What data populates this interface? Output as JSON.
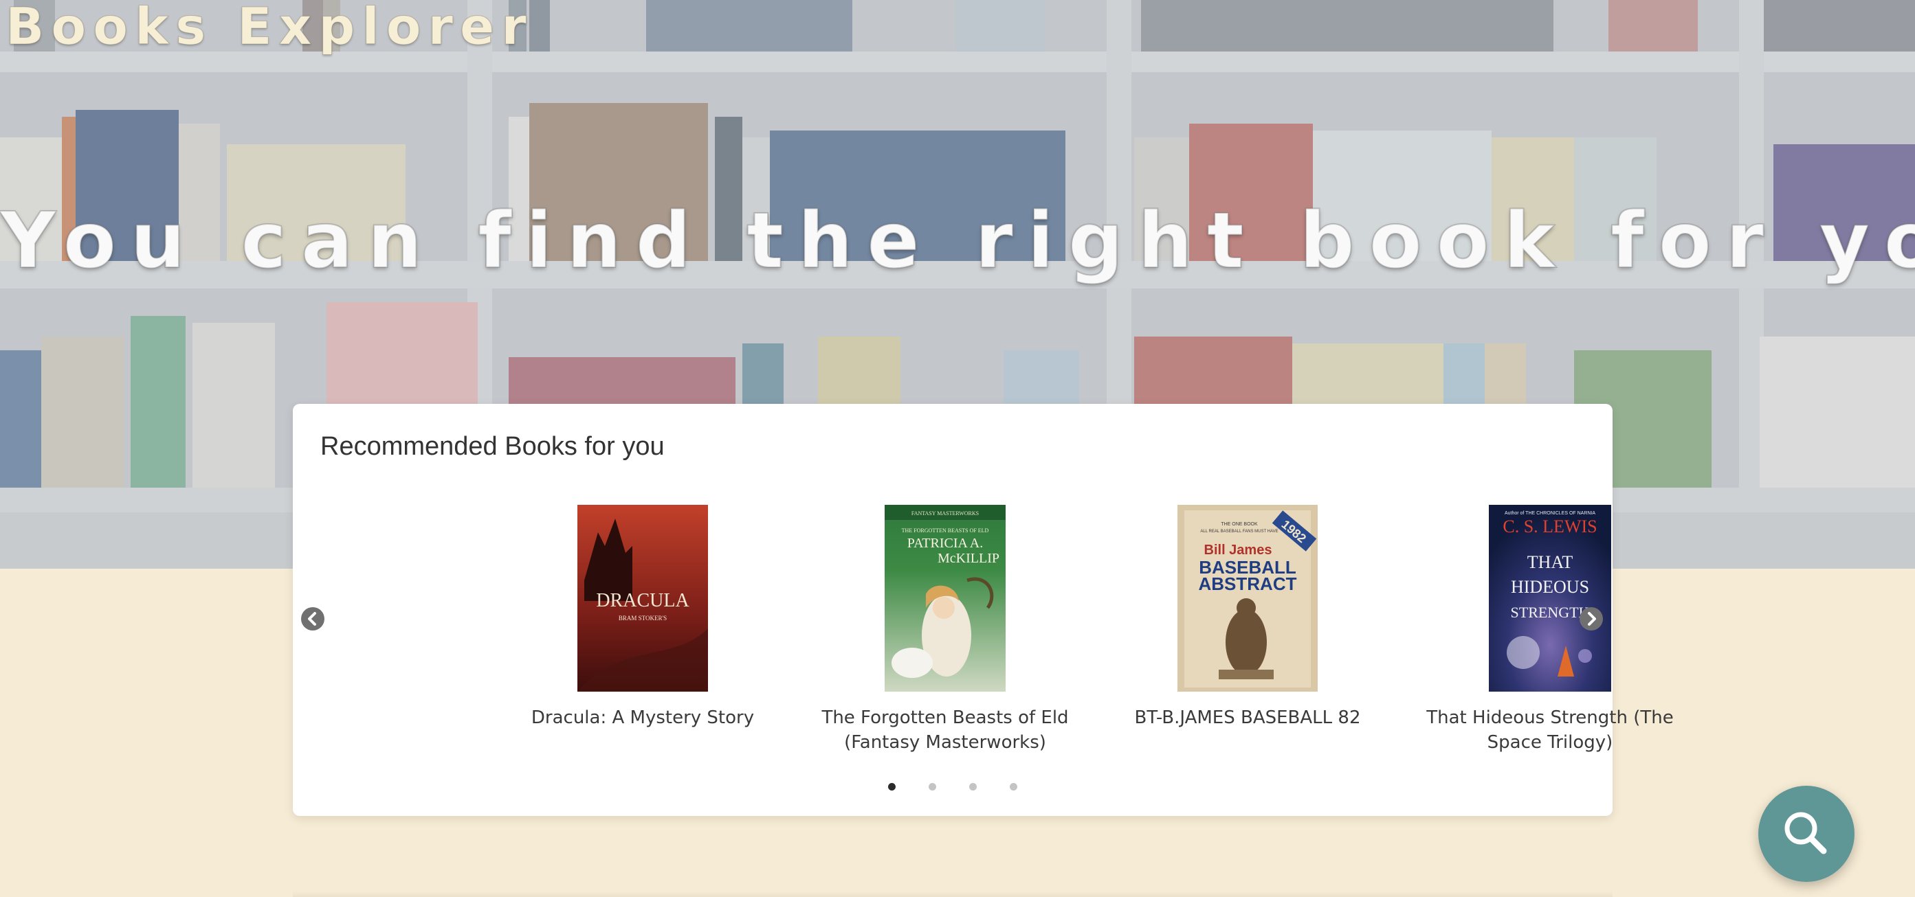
{
  "header": {
    "brand": "Books Explorer",
    "tagline": "You can find the right book for you!"
  },
  "recommendations": {
    "title": "Recommended Books for you",
    "books": [
      {
        "title": "Dracula: A Mystery Story",
        "cover_text": [
          "DRACULA",
          "BRAM STOKER'S"
        ]
      },
      {
        "title": "The Forgotten Beasts of Eld (Fantasy Masterworks)",
        "cover_text": [
          "FANTASY MASTERWORKS",
          "THE FORGOTTEN BEASTS OF ELD",
          "PATRICIA A.",
          "McKILLIP"
        ]
      },
      {
        "title": "BT-B.JAMES BASEBALL 82",
        "cover_text": [
          "THE ONE BOOK",
          "ALL REAL BASEBALL FANS MUST HAVE",
          "Bill James",
          "BASEBALL",
          "ABSTRACT",
          "1982"
        ]
      },
      {
        "title": "That Hideous Strength (The Space Trilogy)",
        "cover_text": [
          "Author of THE CHRONICLES OF NARNIA",
          "C. S. LEWIS",
          "THAT",
          "HIDEOUS",
          "STRENGTH"
        ]
      }
    ],
    "pager": {
      "count": 4,
      "active": 1
    }
  },
  "icons": {
    "prev": "chevron-left-icon",
    "next": "chevron-right-icon",
    "search": "search-icon"
  },
  "colors": {
    "page_background": "#f6ebd4",
    "card_background": "#ffffff",
    "search_button": "#5f9696",
    "arrow_button": "#707070",
    "active_dot": "#2b2b2b",
    "inactive_dot": "#c4c4c4"
  }
}
